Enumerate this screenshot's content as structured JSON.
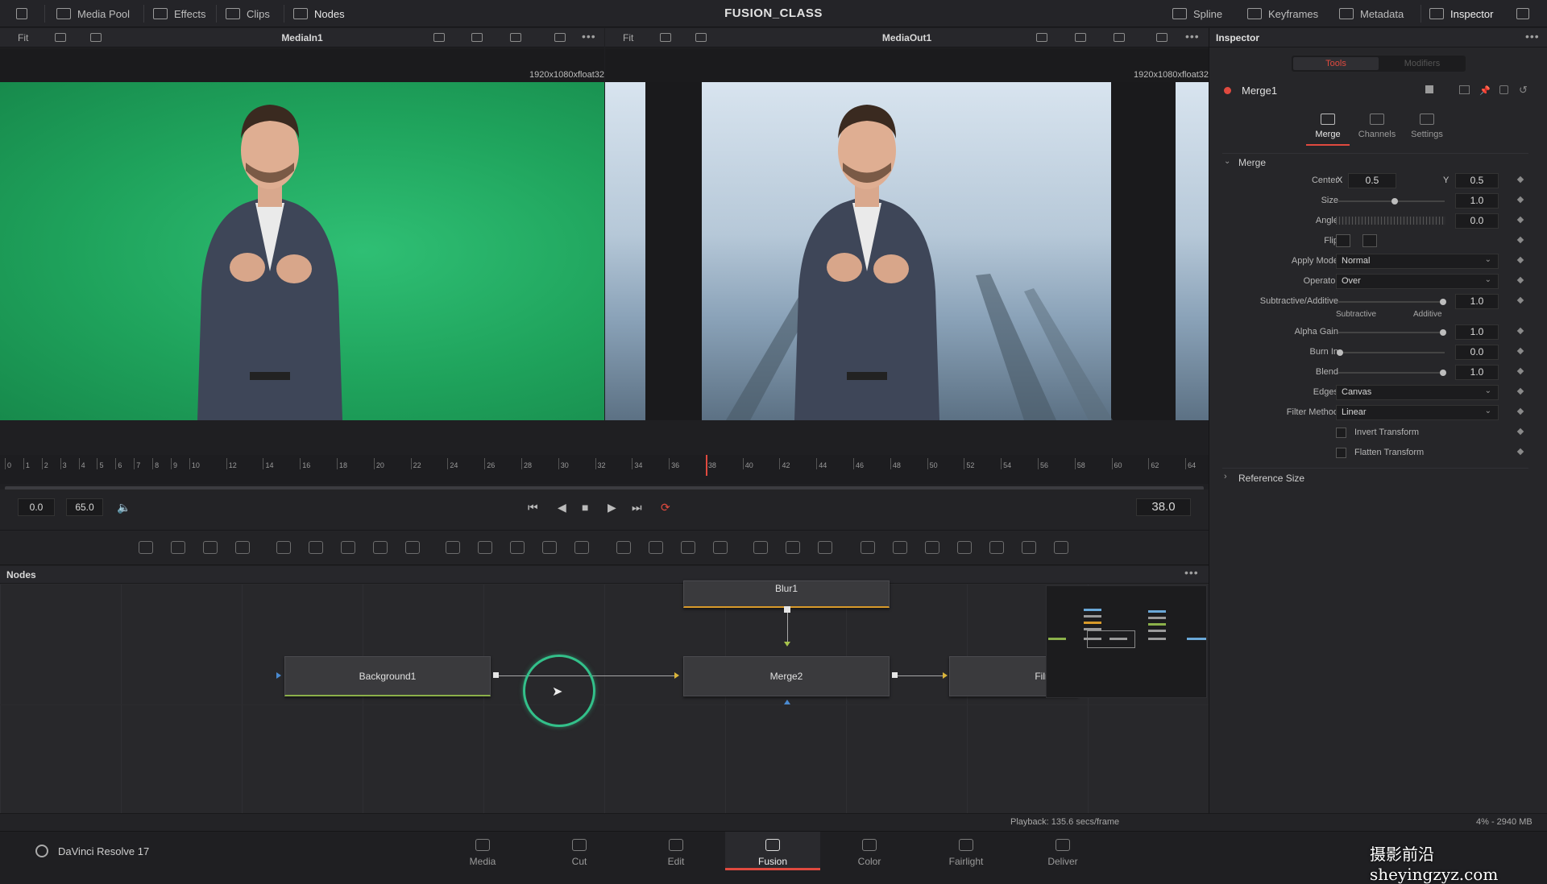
{
  "app_title": "FUSION_CLASS",
  "topbar": {
    "left": [
      "Media Pool",
      "Effects",
      "Clips",
      "Nodes"
    ],
    "right": [
      "Spline",
      "Keyframes",
      "Metadata",
      "Inspector"
    ]
  },
  "viewers": {
    "left": {
      "fit": "Fit",
      "name": "MediaIn1",
      "resolution": "1920x1080xfloat32"
    },
    "right": {
      "fit": "Fit",
      "name": "MediaOut1",
      "resolution": "1920x1080xfloat32"
    }
  },
  "timeline": {
    "ticks": [
      "0",
      "1",
      "2",
      "3",
      "4",
      "5",
      "6",
      "7",
      "8",
      "9",
      "10",
      "12",
      "14",
      "16",
      "18",
      "20",
      "22",
      "24",
      "26",
      "28",
      "30",
      "32",
      "34",
      "36",
      "38",
      "40",
      "42",
      "44",
      "46",
      "48",
      "50",
      "52",
      "54",
      "56",
      "58",
      "60",
      "62",
      "64"
    ],
    "start": "0.0",
    "end": "65.0",
    "current": "38.0"
  },
  "nodes_panel": {
    "title": "Nodes",
    "nodes": {
      "background": "Background1",
      "merge": "Merge2",
      "blur": "Blur1",
      "film": "Film"
    }
  },
  "inspector": {
    "title": "Inspector",
    "tabs": {
      "tools": "Tools",
      "modifiers": "Modifiers"
    },
    "tool_name": "Merge1",
    "subtabs": [
      "Merge",
      "Channels",
      "Settings"
    ],
    "section": "Merge",
    "center_label": "Center",
    "center_x_label": "X",
    "center_x": "0.5",
    "center_y_label": "Y",
    "center_y": "0.5",
    "size_label": "Size",
    "size": "1.0",
    "angle_label": "Angle",
    "angle": "0.0",
    "flip_label": "Flip",
    "apply_mode_label": "Apply Mode",
    "apply_mode": "Normal",
    "operator_label": "Operator",
    "operator": "Over",
    "subadd_label": "Subtractive/Additive",
    "subadd": "1.0",
    "subtractive": "Subtractive",
    "additive": "Additive",
    "alpha_gain_label": "Alpha Gain",
    "alpha_gain": "1.0",
    "burn_in_label": "Burn In",
    "burn_in": "0.0",
    "blend_label": "Blend",
    "blend": "1.0",
    "edges_label": "Edges",
    "edges": "Canvas",
    "filter_label": "Filter Method",
    "filter": "Linear",
    "invert_transform": "Invert Transform",
    "flatten_transform": "Flatten Transform",
    "reference_size": "Reference Size"
  },
  "status": {
    "playback": "Playback: 135.6 secs/frame",
    "memory": "4% - 2940 MB"
  },
  "product": "DaVinci Resolve 17",
  "pages": [
    "Media",
    "Cut",
    "Edit",
    "Fusion",
    "Color",
    "Fairlight",
    "Deliver"
  ],
  "active_page": "Fusion",
  "watermark": "摄影前沿 sheyingzyz.com",
  "colors": {
    "accent": "#e04a3f",
    "green_screen": "#21a05a",
    "node_highlight": "#33c08a"
  }
}
